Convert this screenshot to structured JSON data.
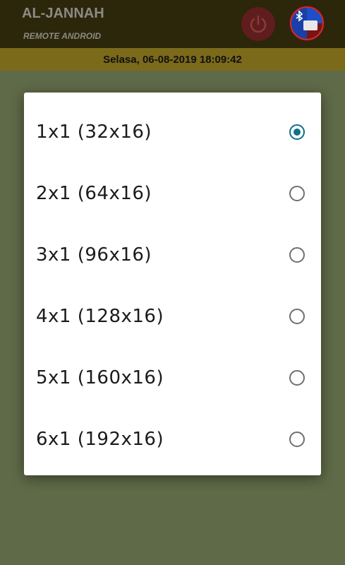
{
  "header": {
    "title": "AL-JANNAH",
    "subtitle": "REMOTE ANDROID",
    "power_icon": "power-icon",
    "bluetooth_icon": "bluetooth-icon"
  },
  "datebar": {
    "datetime": "Selasa, 06-08-2019  18:09:42"
  },
  "dialog": {
    "options": [
      {
        "label": "1x1 (32x16)",
        "selected": true
      },
      {
        "label": "2x1 (64x16)",
        "selected": false
      },
      {
        "label": "3x1 (96x16)",
        "selected": false
      },
      {
        "label": "4x1 (128x16)",
        "selected": false
      },
      {
        "label": "5x1 (160x16)",
        "selected": false
      },
      {
        "label": "6x1 (192x16)",
        "selected": false
      }
    ]
  },
  "colors": {
    "header_bg": "#2c260a",
    "datebar_bg": "#7a6a1a",
    "main_bg": "#5f6a48",
    "radio_accent": "#0e6e8e"
  }
}
